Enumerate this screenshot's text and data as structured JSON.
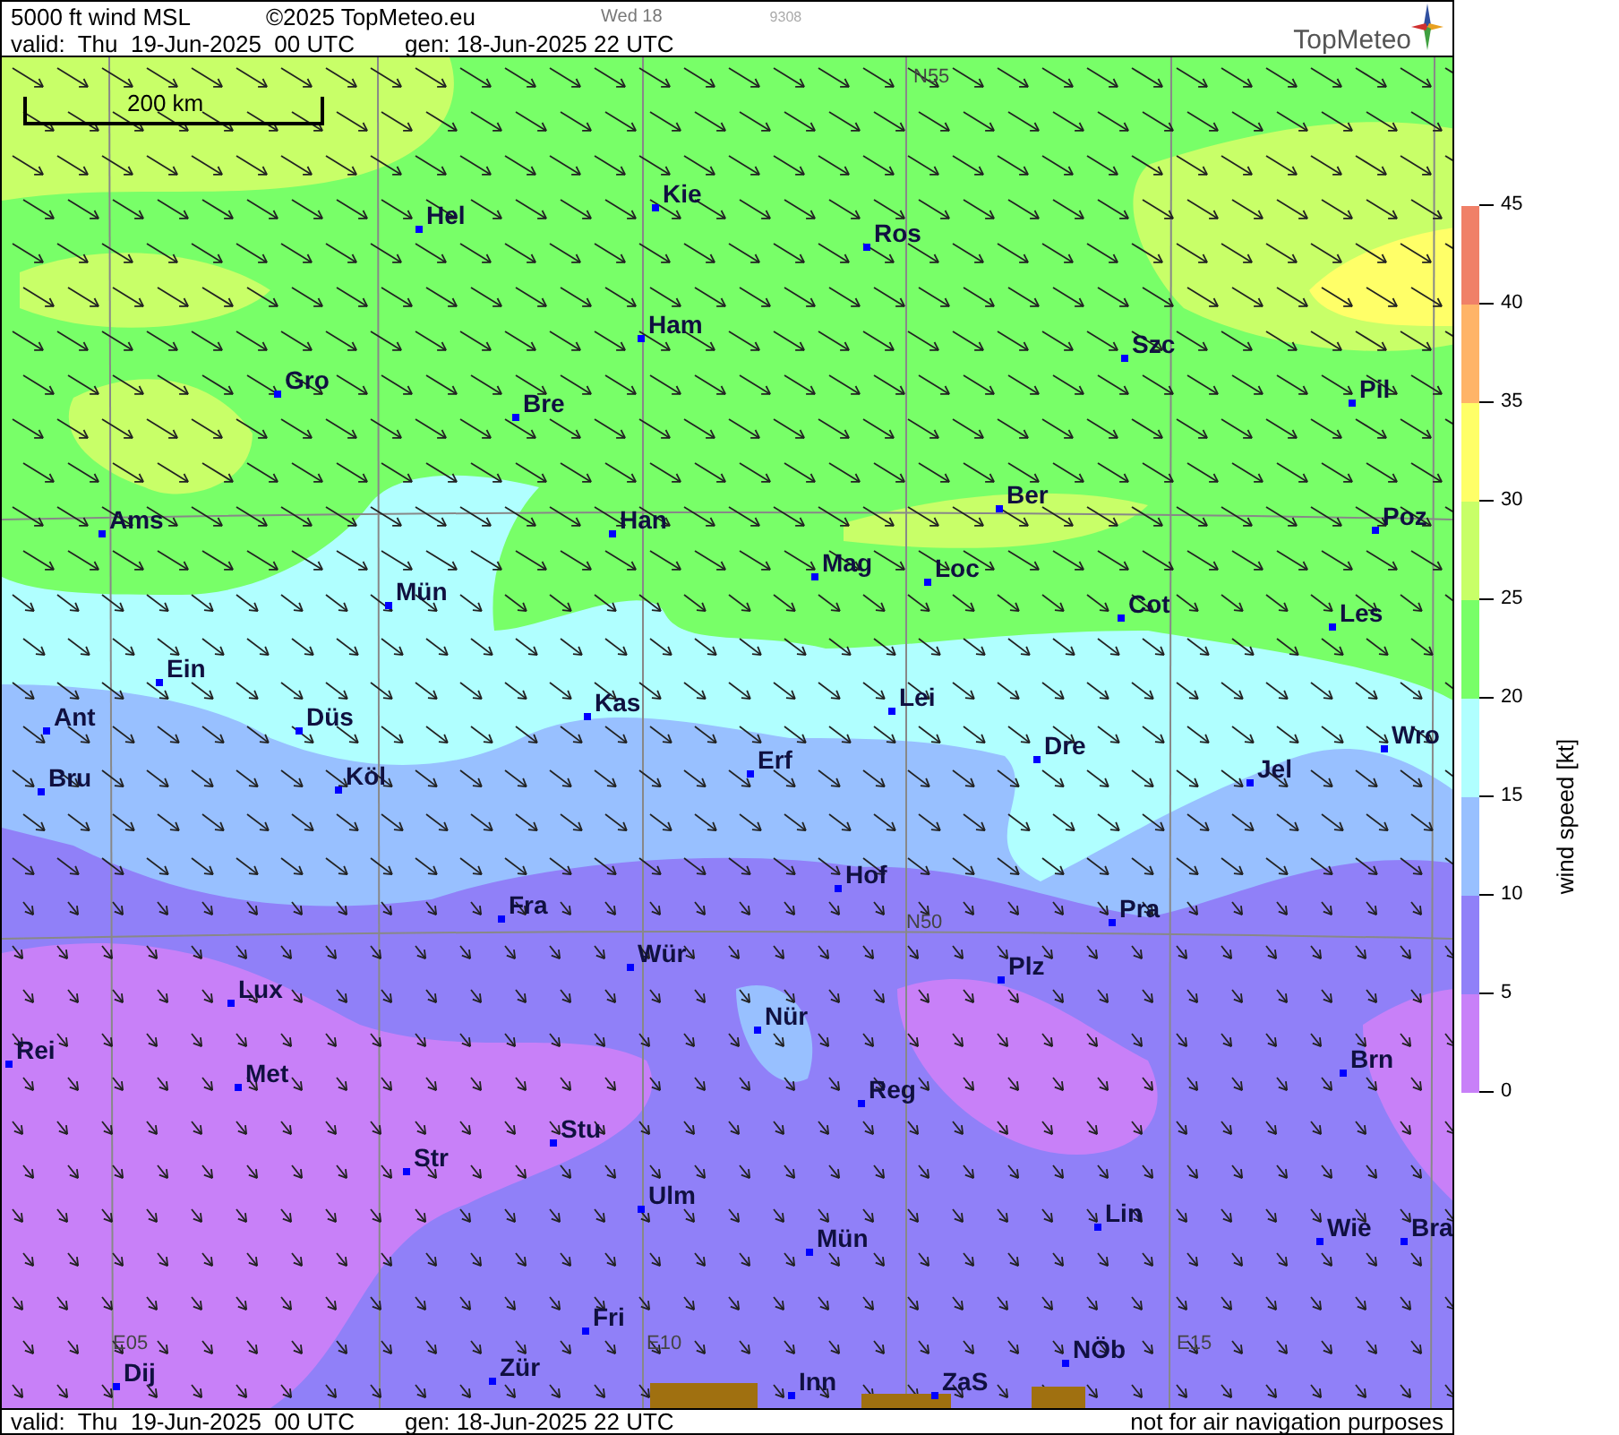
{
  "header": {
    "product": "5000 ft wind MSL",
    "copyright": "©2025 TopMeteo.eu",
    "day": "Wed 18",
    "code": "9308",
    "valid": "valid:  Thu  19-Jun-2025  00 UTC",
    "generated": "gen: 18-Jun-2025 22 UTC",
    "logo": "TopMeteo"
  },
  "map": {
    "scale": "200 km",
    "grid_labels": [
      "N55",
      "N50",
      "E05",
      "E10",
      "E15"
    ],
    "cities": [
      "Hel",
      "Kie",
      "Ros",
      "Ham",
      "Szc",
      "Gro",
      "Bre",
      "Pil",
      "Ber",
      "Ams",
      "Han",
      "Poz",
      "Mag",
      "Loc",
      "Mün",
      "Cot",
      "Les",
      "Ein",
      "Kas",
      "Lei",
      "Ant",
      "Düs",
      "Wro",
      "Dre",
      "Erf",
      "Jel",
      "Bru",
      "Köl",
      "Hof",
      "Fra",
      "Pra",
      "Wür",
      "Plz",
      "Lux",
      "Nür",
      "Rei",
      "Brn",
      "Met",
      "Reg",
      "Stu",
      "Str",
      "Ulm",
      "Lin",
      "Wie",
      "Bra",
      "Mün",
      "Fri",
      "NÖb",
      "Dij",
      "Zür",
      "Inn",
      "ZaS"
    ]
  },
  "legend": {
    "title": "wind speed [kt]",
    "ticks": [
      "45",
      "40",
      "35",
      "30",
      "25",
      "20",
      "15",
      "10",
      "5",
      "0"
    ],
    "segments": [
      {
        "color": "#f08068"
      },
      {
        "color": "#ffb468"
      },
      {
        "color": "#ffff68"
      },
      {
        "color": "#c8ff68"
      },
      {
        "color": "#78ff68"
      },
      {
        "color": "#b0ffff"
      },
      {
        "color": "#98c0ff"
      },
      {
        "color": "#9080f8"
      },
      {
        "color": "#c880f8"
      }
    ]
  },
  "footer": {
    "valid": "valid:  Thu  19-Jun-2025  00 UTC",
    "generated": "gen: 18-Jun-2025 22 UTC",
    "disclaimer": "not for air navigation purposes"
  }
}
